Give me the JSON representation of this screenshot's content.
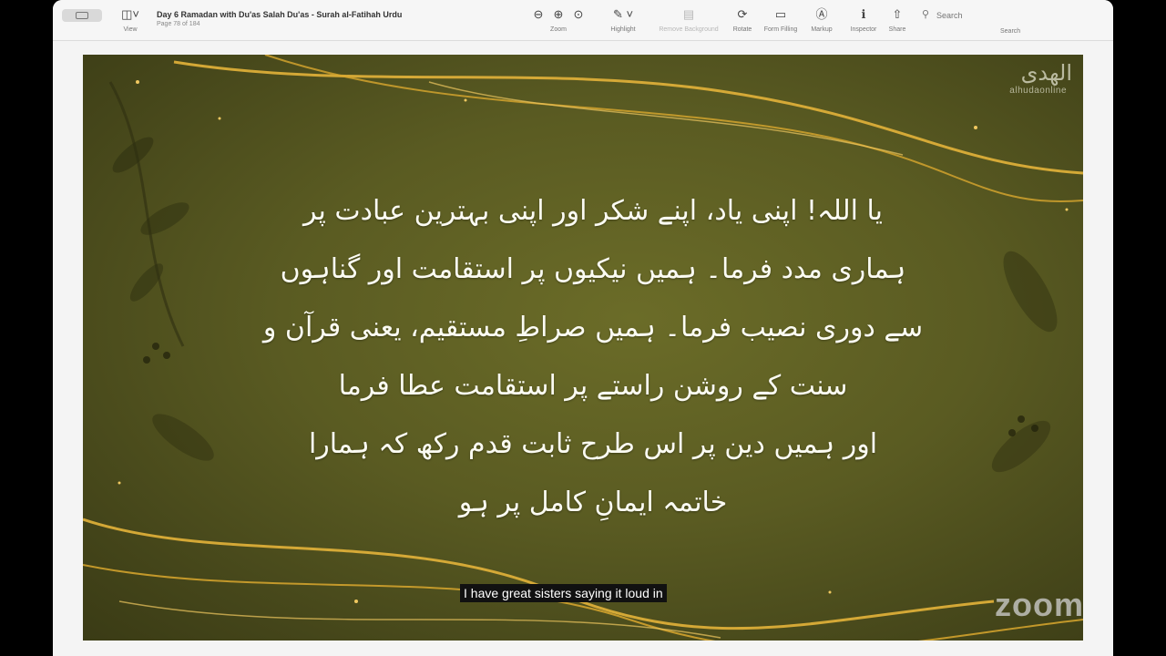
{
  "toolbar": {
    "view_label": "View",
    "doc_title": "Day 6 Ramadan with Du'as Salah Du'as - Surah al-Fatihah Urdu",
    "page_info": "Page 78 of 184",
    "zoom_label": "Zoom",
    "highlight_label": "Highlight",
    "remove_bg_label": "Remove Background",
    "rotate_label": "Rotate",
    "form_filling_label": "Form Filling",
    "markup_label": "Markup",
    "inspector_label": "Inspector",
    "share_label": "Share",
    "search_placeholder": "Search",
    "search_label": "Search"
  },
  "icons": {
    "sidebar": "sidebar-icon",
    "zoom_out": "zoom-out-icon",
    "zoom_in": "zoom-in-icon",
    "zoom_fit": "zoom-fit-icon",
    "highlight": "highlighter-icon",
    "chevron": "chevron-down-icon",
    "remove_bg": "remove-background-icon",
    "rotate": "rotate-icon",
    "form": "form-filling-icon",
    "markup": "markup-icon",
    "inspector": "info-icon",
    "share": "share-icon",
    "search": "search-icon"
  },
  "slide": {
    "logo_text": "الهدى",
    "logo_sub": "alhudaonline",
    "lines": [
      "یا اللہ! اپنی یاد، اپنے شکر اور اپنی بہترین عبادت پر",
      "ہماری مدد فرما۔ ہمیں نیکیوں پر استقامت اور گناہوں",
      "سے دوری نصیب فرما۔ ہمیں صراطِ مستقیم، یعنی قرآن و",
      "سنت کے روشن راستے پر استقامت عطا فرما",
      "اور ہمیں دین پر اس طرح ثابت قدم رکھ کہ ہمارا",
      "خاتمہ ایمانِ کامل پر ہو"
    ]
  },
  "caption_text": "I have great sisters saying it loud in",
  "watermark": "zoom",
  "colors": {
    "slide_bg": "#5a5b22",
    "gold": "#e3b33a",
    "text": "#fbfbf2"
  }
}
